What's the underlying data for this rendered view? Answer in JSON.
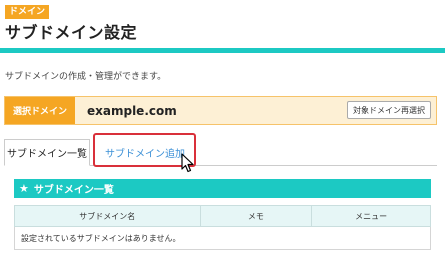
{
  "header": {
    "badge": "ドメイン",
    "title": "サブドメイン設定"
  },
  "description": "サブドメインの作成・管理ができます。",
  "domain_select": {
    "label": "選択ドメイン",
    "value": "example.com",
    "reselect_label": "対象ドメイン再選択"
  },
  "tabs": [
    {
      "label": "サブドメイン一覧",
      "active": true
    },
    {
      "label": "サブドメイン追加",
      "active": false
    }
  ],
  "section": {
    "icon": "star-icon",
    "title": "サブドメイン一覧"
  },
  "table": {
    "columns": [
      "サブドメイン名",
      "メモ",
      "メニュー"
    ],
    "empty_message": "設定されているサブドメインはありません。"
  },
  "colors": {
    "accent_teal": "#1cc9c3",
    "accent_orange": "#f5a623",
    "highlight_red": "#d9303a",
    "link_blue": "#3a8fd6"
  }
}
